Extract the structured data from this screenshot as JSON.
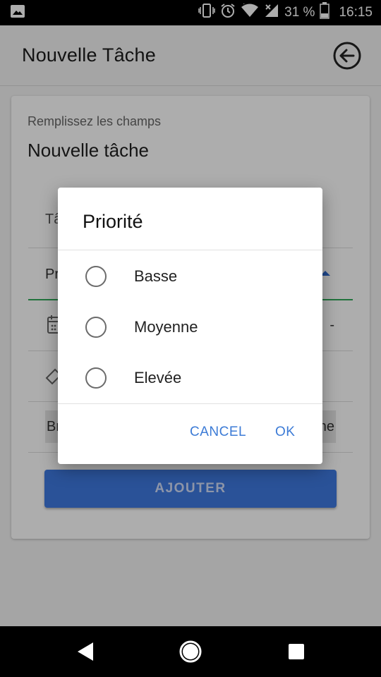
{
  "status_bar": {
    "battery": "31 %",
    "time": "16:15"
  },
  "app_bar": {
    "title": "Nouvelle Tâche"
  },
  "form": {
    "subtitle": "Remplissez les champs",
    "heading": "Nouvelle tâche",
    "task_label_partial": "Tâ",
    "priority_label_partial": "Pr",
    "date_value_partial": "-",
    "chip_left_partial": "Bri",
    "chip_right_partial": "ne",
    "add_button": "AJOUTER"
  },
  "dialog": {
    "title": "Priorité",
    "options": [
      {
        "label": "Basse",
        "selected": false
      },
      {
        "label": "Moyenne",
        "selected": false
      },
      {
        "label": "Elevée",
        "selected": false
      }
    ],
    "cancel": "CANCEL",
    "ok": "OK"
  },
  "colors": {
    "accent": "#3f79e0",
    "dialog_button": "#3c7bd6",
    "field_focus": "#31a85a"
  }
}
